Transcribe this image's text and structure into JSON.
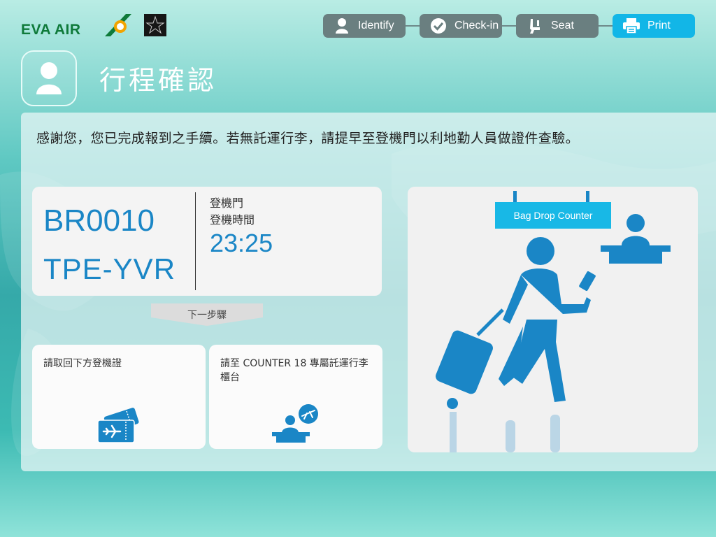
{
  "brand": {
    "name": "EVA AIR"
  },
  "steps": [
    {
      "label": "Identify",
      "icon": "user-icon",
      "active": false
    },
    {
      "label": "Check-in",
      "icon": "check-circle-icon",
      "active": false
    },
    {
      "label": "Seat",
      "icon": "seat-icon",
      "active": false
    },
    {
      "label": "Print",
      "icon": "printer-icon",
      "active": true
    }
  ],
  "page": {
    "title": "行程確認"
  },
  "message": "感謝您，您已完成報到之手續。若無託運行李，請提早至登機門以利地勤人員做證件查驗。",
  "flight": {
    "number": "BR0010",
    "route": "TPE-YVR",
    "gate_label": "登機門",
    "time_label": "登機時間",
    "time_value": "23:25"
  },
  "next_step_label": "下一步驟",
  "cards": [
    {
      "text": "請取回下方登機證",
      "icon": "boarding-pass-icon"
    },
    {
      "text": "請至 COUNTER 18 專屬託運行李櫃台",
      "icon": "counter-agent-icon"
    }
  ],
  "illustration": {
    "sign_label": "Bag Drop Counter"
  },
  "colors": {
    "accent": "#12b6e7",
    "step_inactive": "#6a7f80",
    "flight_blue": "#1a86c6",
    "brand_green": "#0f7a3a"
  }
}
